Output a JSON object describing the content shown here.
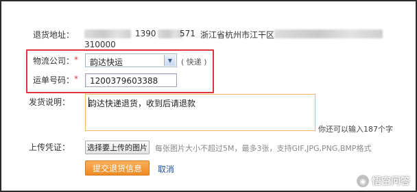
{
  "address": {
    "label": "退货地址：",
    "phone": "1390",
    "phone_suffix": "571",
    "city": "浙江省杭州市江干区",
    "zip": "310000"
  },
  "logistics": {
    "label": "物流公司：",
    "required_mark": "*",
    "selected": "韵达快运",
    "hint": "( 快递 )"
  },
  "tracking": {
    "label": "运单号码：",
    "required_mark": "*",
    "value": "1200379603388"
  },
  "note": {
    "label": "发货说明：",
    "value": "韵达快递退货，收到后请退款",
    "remaining": "你还可以输入187个字"
  },
  "upload": {
    "label": "上传凭证：",
    "button": "选择要上传的图片",
    "hint": "每张图片大小不超过5M，最多3张，支持GIF,JPG,PNG,BMP格式"
  },
  "actions": {
    "submit": "提交退货信息",
    "cancel": "取消"
  },
  "watermark": {
    "text": "悟空问答"
  },
  "colors": {
    "highlight_border": "#e0323a",
    "submit_bg": "#ee8a22",
    "link": "#1f4f9f"
  }
}
